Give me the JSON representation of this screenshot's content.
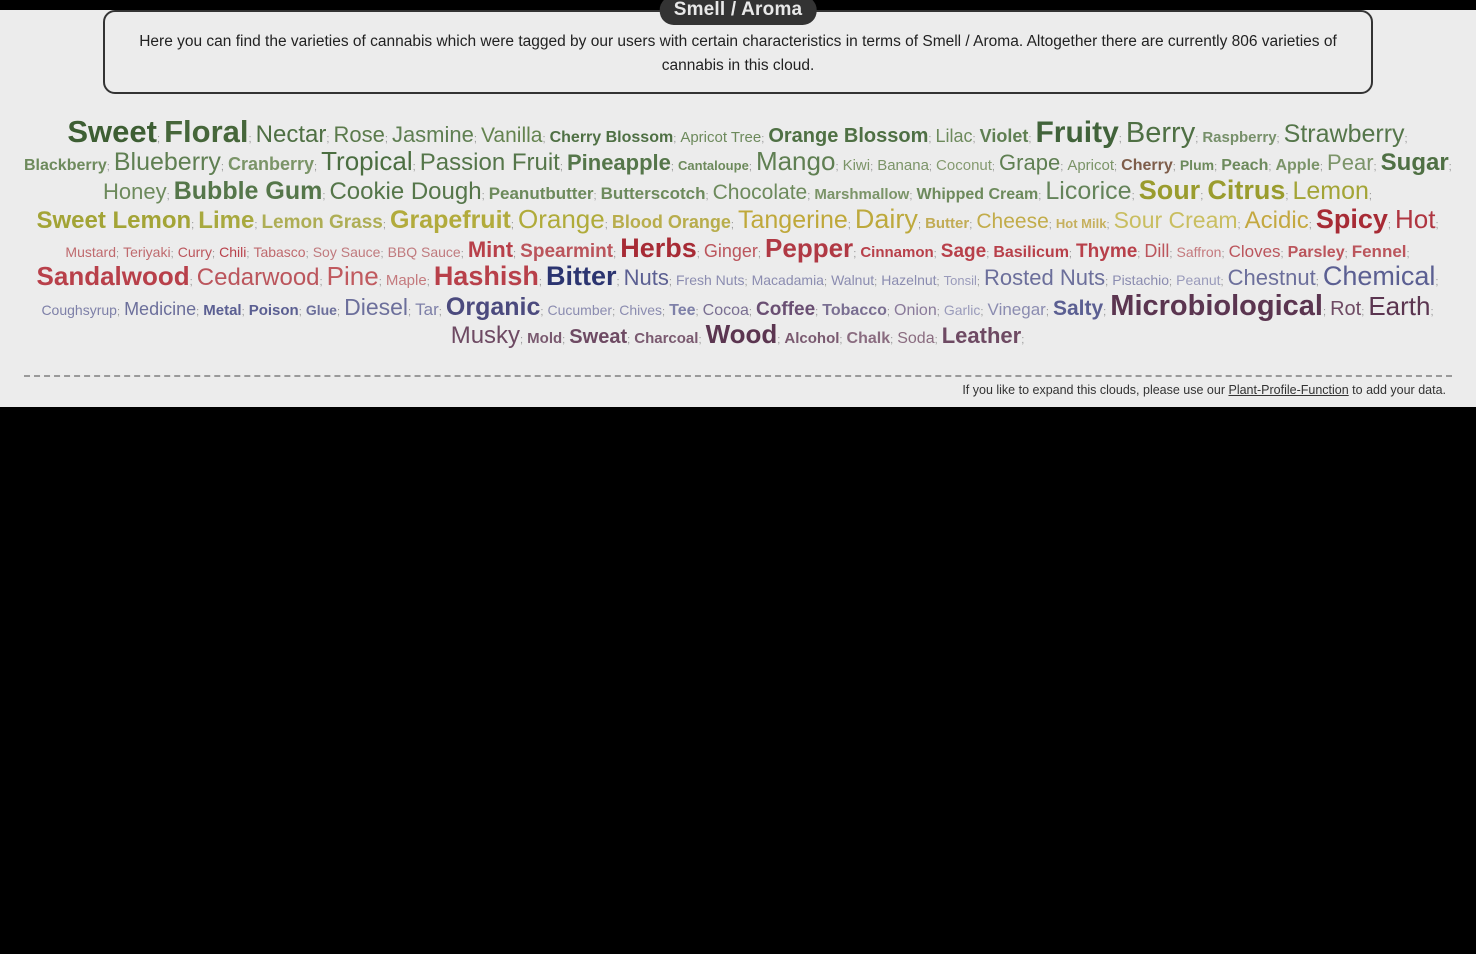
{
  "page": {
    "background": "#ececec",
    "outer_background": "#000000"
  },
  "header": {
    "title": "Smell / Aroma",
    "description": "Here you can find the varieties of cannabis which were tagged by our users with certain characteristics in terms of Smell / Aroma. Altogether there are currently 806 varieties of cannabis in this cloud.",
    "variety_count": "806"
  },
  "footer": {
    "prefix": "If you like to expand this clouds, please use our",
    "link": "Plant-Profile-Function",
    "suffix": "to add your data."
  },
  "palette": {
    "dark_green": "#3d5e33",
    "green": "#4f7044",
    "mid_green": "#5f7f52",
    "light_green": "#7b9468",
    "pale_green": "#8a9d76",
    "olive": "#9a9c2e",
    "olive_light": "#a8a93f",
    "yellow_olive": "#b0ab3a",
    "gold": "#bfa83a",
    "mustard": "#c2a63f",
    "orange_gold": "#c79a3c",
    "dark_red": "#a72b35",
    "red": "#b8404a",
    "soft_red": "#c05a5f",
    "rose": "#c47a7e",
    "navy": "#2b3470",
    "indigo": "#4a4e86",
    "slate_blue": "#6c6f9b",
    "lavender": "#8b8cb0",
    "plum": "#5b3550",
    "purple": "#6e4a63",
    "mauve": "#8a6c80",
    "separator": "#9a9a9a"
  },
  "cloud": {
    "separator": ";",
    "tags": [
      {
        "label": "Sweet",
        "size": 31,
        "weight": "bold",
        "color": "#3d5e33"
      },
      {
        "label": "Floral",
        "size": 31,
        "weight": "bold",
        "color": "#46663a"
      },
      {
        "label": "Nectar",
        "size": 24,
        "weight": "normal",
        "color": "#4f7044"
      },
      {
        "label": "Rose",
        "size": 22,
        "weight": "normal",
        "color": "#5b7a4c"
      },
      {
        "label": "Jasmine",
        "size": 22,
        "weight": "normal",
        "color": "#5f7f52"
      },
      {
        "label": "Vanilla",
        "size": 21,
        "weight": "normal",
        "color": "#64834f"
      },
      {
        "label": "Cherry Blossom",
        "size": 16,
        "weight": "bold",
        "color": "#4f7044"
      },
      {
        "label": "Apricot Tree",
        "size": 15,
        "weight": "normal",
        "color": "#6d8a5c"
      },
      {
        "label": "Orange Blossom",
        "size": 20,
        "weight": "bold",
        "color": "#4f7044"
      },
      {
        "label": "Lilac",
        "size": 18,
        "weight": "normal",
        "color": "#6d8a5c"
      },
      {
        "label": "Violet",
        "size": 18,
        "weight": "bold",
        "color": "#5f7f52"
      },
      {
        "label": "Fruity",
        "size": 30,
        "weight": "bold",
        "color": "#41633a"
      },
      {
        "label": "Berry",
        "size": 29,
        "weight": "normal",
        "color": "#4f7044"
      },
      {
        "label": "Raspberry",
        "size": 15,
        "weight": "bold",
        "color": "#77906a"
      },
      {
        "label": "Strawberry",
        "size": 25,
        "weight": "normal",
        "color": "#55764a"
      },
      {
        "label": "Blackberry",
        "size": 16,
        "weight": "bold",
        "color": "#6d8a5c"
      },
      {
        "label": "Blueberry",
        "size": 25,
        "weight": "normal",
        "color": "#5f7f52"
      },
      {
        "label": "Cranberry",
        "size": 18,
        "weight": "bold",
        "color": "#7b9468"
      },
      {
        "label": "Tropical",
        "size": 26,
        "weight": "normal",
        "color": "#4b6e41"
      },
      {
        "label": "Passion Fruit",
        "size": 24,
        "weight": "normal",
        "color": "#55764a"
      },
      {
        "label": "Pineapple",
        "size": 22,
        "weight": "bold",
        "color": "#55764a"
      },
      {
        "label": "Cantaloupe",
        "size": 13,
        "weight": "bold",
        "color": "#6d8a5c"
      },
      {
        "label": "Mango",
        "size": 26,
        "weight": "normal",
        "color": "#5f7f52"
      },
      {
        "label": "Kiwi",
        "size": 15,
        "weight": "normal",
        "color": "#7b9468"
      },
      {
        "label": "Banana",
        "size": 15,
        "weight": "normal",
        "color": "#7b9468"
      },
      {
        "label": "Coconut",
        "size": 15,
        "weight": "normal",
        "color": "#849a70"
      },
      {
        "label": "Grape",
        "size": 22,
        "weight": "normal",
        "color": "#5f7f52"
      },
      {
        "label": "Apricot",
        "size": 15,
        "weight": "normal",
        "color": "#7b9468"
      },
      {
        "label": "Cherry",
        "size": 16,
        "weight": "bold",
        "color": "#7e5d4a"
      },
      {
        "label": "Plum",
        "size": 14,
        "weight": "bold",
        "color": "#6d8a5c"
      },
      {
        "label": "Peach",
        "size": 16,
        "weight": "bold",
        "color": "#6d8a5c"
      },
      {
        "label": "Apple",
        "size": 16,
        "weight": "bold",
        "color": "#7b9468"
      },
      {
        "label": "Pear",
        "size": 22,
        "weight": "normal",
        "color": "#7b9468"
      },
      {
        "label": "Sugar",
        "size": 24,
        "weight": "bold",
        "color": "#4f7044"
      },
      {
        "label": "Honey",
        "size": 22,
        "weight": "normal",
        "color": "#6d8a5c"
      },
      {
        "label": "Bubble Gum",
        "size": 25,
        "weight": "bold",
        "color": "#55764a"
      },
      {
        "label": "Cookie Dough",
        "size": 24,
        "weight": "normal",
        "color": "#55764a"
      },
      {
        "label": "Peanutbutter",
        "size": 17,
        "weight": "bold",
        "color": "#6d8a5c"
      },
      {
        "label": "Butterscotch",
        "size": 17,
        "weight": "bold",
        "color": "#6d8a5c"
      },
      {
        "label": "Chocolate",
        "size": 21,
        "weight": "normal",
        "color": "#6d8a5c"
      },
      {
        "label": "Marshmallow",
        "size": 15,
        "weight": "bold",
        "color": "#7b9468"
      },
      {
        "label": "Whipped Cream",
        "size": 16,
        "weight": "bold",
        "color": "#6d8a5c"
      },
      {
        "label": "Licorice",
        "size": 25,
        "weight": "normal",
        "color": "#64835a"
      },
      {
        "label": "Sour",
        "size": 27,
        "weight": "bold",
        "color": "#9a9c2e"
      },
      {
        "label": "Citrus",
        "size": 27,
        "weight": "bold",
        "color": "#9a9c2e"
      },
      {
        "label": "Lemon",
        "size": 25,
        "weight": "normal",
        "color": "#a3a436"
      },
      {
        "label": "Sweet Lemon",
        "size": 24,
        "weight": "bold",
        "color": "#a3a436"
      },
      {
        "label": "Lime",
        "size": 24,
        "weight": "bold",
        "color": "#a8a93f"
      },
      {
        "label": "Lemon Grass",
        "size": 19,
        "weight": "bold",
        "color": "#aeae55"
      },
      {
        "label": "Grapefruit",
        "size": 25,
        "weight": "bold",
        "color": "#b2ab3c"
      },
      {
        "label": "Orange",
        "size": 26,
        "weight": "normal",
        "color": "#b0ab3a"
      },
      {
        "label": "Blood Orange",
        "size": 18,
        "weight": "bold",
        "color": "#b8ad4c"
      },
      {
        "label": "Tangerine",
        "size": 25,
        "weight": "normal",
        "color": "#bfa83a"
      },
      {
        "label": "Dairy",
        "size": 27,
        "weight": "normal",
        "color": "#bda93c"
      },
      {
        "label": "Butter",
        "size": 15,
        "weight": "bold",
        "color": "#c2ac55"
      },
      {
        "label": "Cheese",
        "size": 21,
        "weight": "normal",
        "color": "#c2ac4a"
      },
      {
        "label": "Hot Milk",
        "size": 13,
        "weight": "bold",
        "color": "#c6b05e"
      },
      {
        "label": "Sour Cream",
        "size": 23,
        "weight": "normal",
        "color": "#c9be60"
      },
      {
        "label": "Acidic",
        "size": 24,
        "weight": "normal",
        "color": "#c4a840"
      },
      {
        "label": "Spicy",
        "size": 27,
        "weight": "bold",
        "color": "#a72b35"
      },
      {
        "label": "Hot",
        "size": 26,
        "weight": "normal",
        "color": "#af3540"
      },
      {
        "label": "Mustard",
        "size": 14,
        "weight": "normal",
        "color": "#bf6a6e"
      },
      {
        "label": "Teriyaki",
        "size": 14,
        "weight": "normal",
        "color": "#bf6a6e"
      },
      {
        "label": "Curry",
        "size": 14,
        "weight": "normal",
        "color": "#bb555c"
      },
      {
        "label": "Chili",
        "size": 14,
        "weight": "normal",
        "color": "#b8404a"
      },
      {
        "label": "Tabasco",
        "size": 14,
        "weight": "normal",
        "color": "#bf6a6e"
      },
      {
        "label": "Soy Sauce",
        "size": 14,
        "weight": "normal",
        "color": "#c07a7e"
      },
      {
        "label": "BBQ Sauce",
        "size": 14,
        "weight": "normal",
        "color": "#c07a7e"
      },
      {
        "label": "Mint",
        "size": 22,
        "weight": "bold",
        "color": "#b8404a"
      },
      {
        "label": "Spearmint",
        "size": 19,
        "weight": "bold",
        "color": "#bb555c"
      },
      {
        "label": "Herbs",
        "size": 27,
        "weight": "bold",
        "color": "#a72b35"
      },
      {
        "label": "Ginger",
        "size": 18,
        "weight": "normal",
        "color": "#bb555c"
      },
      {
        "label": "Pepper",
        "size": 26,
        "weight": "bold",
        "color": "#b03944"
      },
      {
        "label": "Cinnamon",
        "size": 15,
        "weight": "bold",
        "color": "#b8404a"
      },
      {
        "label": "Sage",
        "size": 19,
        "weight": "bold",
        "color": "#b8404a"
      },
      {
        "label": "Basilicum",
        "size": 16,
        "weight": "bold",
        "color": "#b8404a"
      },
      {
        "label": "Thyme",
        "size": 19,
        "weight": "bold",
        "color": "#b8404a"
      },
      {
        "label": "Dill",
        "size": 18,
        "weight": "normal",
        "color": "#bb555c"
      },
      {
        "label": "Saffron",
        "size": 14,
        "weight": "normal",
        "color": "#c47a7e"
      },
      {
        "label": "Cloves",
        "size": 17,
        "weight": "normal",
        "color": "#bb555c"
      },
      {
        "label": "Parsley",
        "size": 16,
        "weight": "bold",
        "color": "#bb555c"
      },
      {
        "label": "Fennel",
        "size": 17,
        "weight": "bold",
        "color": "#bb555c"
      },
      {
        "label": "Sandalwood",
        "size": 26,
        "weight": "bold",
        "color": "#b8404a"
      },
      {
        "label": "Cedarwood",
        "size": 24,
        "weight": "normal",
        "color": "#bb555c"
      },
      {
        "label": "Pine",
        "size": 26,
        "weight": "normal",
        "color": "#c05a5f"
      },
      {
        "label": "Maple",
        "size": 15,
        "weight": "normal",
        "color": "#c47a7e"
      },
      {
        "label": "Hashish",
        "size": 27,
        "weight": "bold",
        "color": "#b8404a"
      },
      {
        "label": "Bitter",
        "size": 27,
        "weight": "bold",
        "color": "#2b3470"
      },
      {
        "label": "Nuts",
        "size": 22,
        "weight": "normal",
        "color": "#5b5f92"
      },
      {
        "label": "Fresh Nuts",
        "size": 14,
        "weight": "normal",
        "color": "#8b8cb0"
      },
      {
        "label": "Macadamia",
        "size": 14,
        "weight": "normal",
        "color": "#8b8cb0"
      },
      {
        "label": "Walnut",
        "size": 14,
        "weight": "normal",
        "color": "#8b8cb0"
      },
      {
        "label": "Hazelnut",
        "size": 14,
        "weight": "normal",
        "color": "#8b8cb0"
      },
      {
        "label": "Tonsil",
        "size": 13,
        "weight": "normal",
        "color": "#9a9bbb"
      },
      {
        "label": "Rosted Nuts",
        "size": 22,
        "weight": "normal",
        "color": "#6c6f9b"
      },
      {
        "label": "Pistachio",
        "size": 14,
        "weight": "normal",
        "color": "#8b8cb0"
      },
      {
        "label": "Peanut",
        "size": 14,
        "weight": "normal",
        "color": "#9a9bbb"
      },
      {
        "label": "Chestnut",
        "size": 22,
        "weight": "normal",
        "color": "#6c6f9b"
      },
      {
        "label": "Chemical",
        "size": 27,
        "weight": "normal",
        "color": "#5b5f92"
      },
      {
        "label": "Coughsyrup",
        "size": 14,
        "weight": "normal",
        "color": "#7e80a8"
      },
      {
        "label": "Medicine",
        "size": 18,
        "weight": "normal",
        "color": "#6c6f9b"
      },
      {
        "label": "Metal",
        "size": 15,
        "weight": "bold",
        "color": "#5b5f92"
      },
      {
        "label": "Poison",
        "size": 15,
        "weight": "bold",
        "color": "#5b5f92"
      },
      {
        "label": "Glue",
        "size": 14,
        "weight": "bold",
        "color": "#6c6f9b"
      },
      {
        "label": "Diesel",
        "size": 23,
        "weight": "normal",
        "color": "#6c6f9b"
      },
      {
        "label": "Tar",
        "size": 17,
        "weight": "normal",
        "color": "#7e80a8"
      },
      {
        "label": "Organic",
        "size": 25,
        "weight": "bold",
        "color": "#4b4a7e"
      },
      {
        "label": "Cucumber",
        "size": 14,
        "weight": "normal",
        "color": "#8b8cb0"
      },
      {
        "label": "Chives",
        "size": 14,
        "weight": "normal",
        "color": "#8b8cb0"
      },
      {
        "label": "Tee",
        "size": 16,
        "weight": "bold",
        "color": "#7e80a8"
      },
      {
        "label": "Cocoa",
        "size": 16,
        "weight": "normal",
        "color": "#7a6f92"
      },
      {
        "label": "Coffee",
        "size": 19,
        "weight": "bold",
        "color": "#6a4f73"
      },
      {
        "label": "Tobacco",
        "size": 16,
        "weight": "bold",
        "color": "#7a6f92"
      },
      {
        "label": "Onion",
        "size": 16,
        "weight": "normal",
        "color": "#8a7a9a"
      },
      {
        "label": "Garlic",
        "size": 14,
        "weight": "normal",
        "color": "#9a9bbb"
      },
      {
        "label": "Vinegar",
        "size": 17,
        "weight": "normal",
        "color": "#8b8cb0"
      },
      {
        "label": "Salty",
        "size": 21,
        "weight": "bold",
        "color": "#5b5f92"
      },
      {
        "label": "Microbiological",
        "size": 29,
        "weight": "bold",
        "color": "#5b3550"
      },
      {
        "label": "Rot",
        "size": 20,
        "weight": "normal",
        "color": "#6e4a63"
      },
      {
        "label": "Earth",
        "size": 26,
        "weight": "normal",
        "color": "#5b3550"
      },
      {
        "label": "Musky",
        "size": 24,
        "weight": "normal",
        "color": "#6e4a63"
      },
      {
        "label": "Mold",
        "size": 15,
        "weight": "bold",
        "color": "#7a5a70"
      },
      {
        "label": "Sweat",
        "size": 20,
        "weight": "bold",
        "color": "#6e4a63"
      },
      {
        "label": "Charcoal",
        "size": 15,
        "weight": "bold",
        "color": "#7a5a70"
      },
      {
        "label": "Wood",
        "size": 26,
        "weight": "bold",
        "color": "#5b3550"
      },
      {
        "label": "Alcohol",
        "size": 15,
        "weight": "bold",
        "color": "#7a5a70"
      },
      {
        "label": "Chalk",
        "size": 16,
        "weight": "bold",
        "color": "#8a6c80"
      },
      {
        "label": "Soda",
        "size": 16,
        "weight": "normal",
        "color": "#8a6c80"
      },
      {
        "label": "Leather",
        "size": 22,
        "weight": "bold",
        "color": "#6e4a63"
      }
    ]
  }
}
